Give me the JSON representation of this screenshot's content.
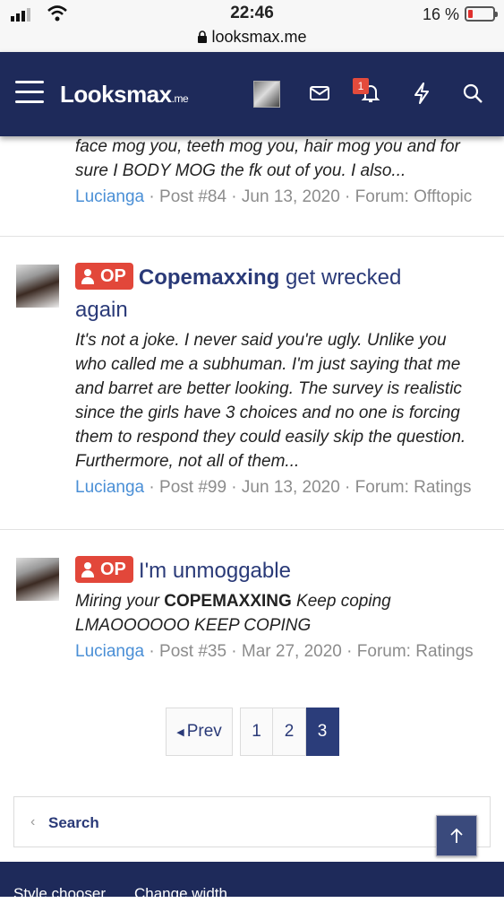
{
  "status_bar": {
    "time": "22:46",
    "url": "looksmax.me",
    "battery": "16 %"
  },
  "nav": {
    "logo_text": "Looksmax",
    "logo_suffix": ".me",
    "notifications_count": "1",
    "icons": [
      "menu-icon",
      "avatar",
      "mail-icon",
      "bell-icon",
      "lightning-icon",
      "search-icon"
    ]
  },
  "posts": [
    {
      "snippet_lines": [
        "face mog you, teeth mog you, hair mog you and for",
        "sure I BODY MOG the fk out of you. I also..."
      ],
      "author": "Lucianga",
      "post_no": "Post #84",
      "date": "Jun 13, 2020",
      "forum": "Forum: Offtopic"
    },
    {
      "badge": "OP",
      "title_bold": "Copemaxxing",
      "title_rest": " get wrecked",
      "title_line2": "again",
      "snippet_lines": [
        "It's not a joke. I never said you're ugly. Unlike you",
        "who called me a subhuman. I'm just saying that me",
        "and barret are better looking. The survey is realistic",
        "since the girls have 3 choices and no one is forcing",
        "them to respond they could easily skip the question.",
        "Furthermore, not all of them..."
      ],
      "author": "Lucianga",
      "post_no": "Post #99",
      "date": "Jun 13, 2020",
      "forum": "Forum: Ratings"
    },
    {
      "badge": "OP",
      "title": "I'm unmoggable",
      "snippet_pre": "Miring your ",
      "snippet_bold": "COPEMAXXING",
      "snippet_post": " Keep coping",
      "snippet_line2": "LMAOOOOOO KEEP COPING",
      "author": "Lucianga",
      "post_no": "Post #35",
      "date": "Mar 27, 2020",
      "forum": "Forum: Ratings"
    }
  ],
  "meta_sep": " · ",
  "pagination": {
    "prev_label": "Prev",
    "pages": [
      "1",
      "2",
      "3"
    ],
    "current": "3"
  },
  "search": {
    "label": "Search"
  },
  "footer": {
    "links": [
      "Style chooser",
      "Change width"
    ]
  },
  "colors": {
    "nav_bg": "#1e2a5a",
    "op_badge": "#e2473a",
    "title": "#2a3a78",
    "author": "#4a8fd6"
  }
}
